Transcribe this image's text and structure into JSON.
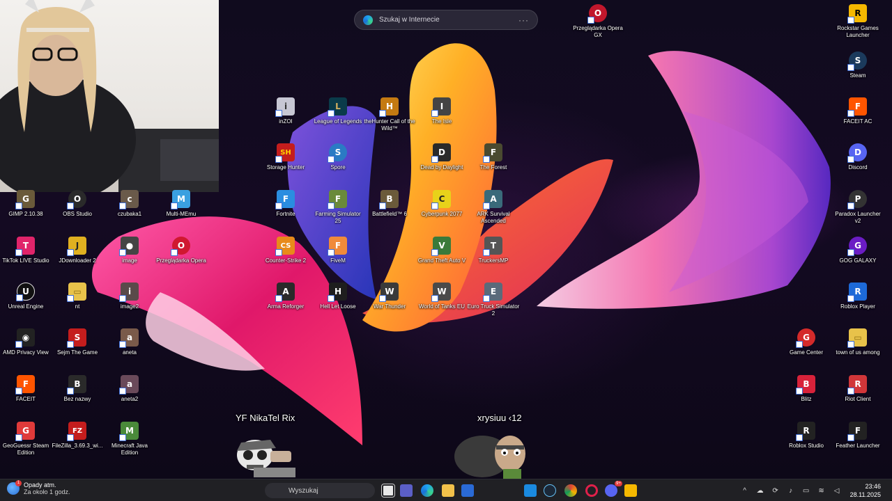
{
  "browser_search": {
    "placeholder": "Szukaj w Internecie",
    "more": "···"
  },
  "overlay": {
    "player1": "YF NikaTel Rix",
    "player2": "xrysiuu ‹12"
  },
  "icons": [
    {
      "id": "opera-gx",
      "label": "Przeglądarka Opera GX",
      "color": "#c1172c",
      "glyph": "O"
    },
    {
      "id": "rockstar",
      "label": "Rockstar Games Launcher",
      "color": "#f5b800",
      "glyph": "R"
    },
    {
      "id": "steam",
      "label": "Steam",
      "color": "#1b3a5c",
      "glyph": "S"
    },
    {
      "id": "faceit-ac",
      "label": "FACEIT AC",
      "color": "#ff5500",
      "glyph": "F"
    },
    {
      "id": "discord",
      "label": "Discord",
      "color": "#5865f2",
      "glyph": "D"
    },
    {
      "id": "paradox",
      "label": "Paradox Launcher v2",
      "color": "#333",
      "glyph": "P"
    },
    {
      "id": "gog",
      "label": "GOG GALAXY",
      "color": "#6b1cc4",
      "glyph": "G"
    },
    {
      "id": "roblox-player",
      "label": "Roblox Player",
      "color": "#1d6ad8",
      "glyph": "R"
    },
    {
      "id": "game-center",
      "label": "Game Center",
      "color": "#d42a2a",
      "glyph": "G"
    },
    {
      "id": "town-of-us",
      "label": "town of us among",
      "color": "#e8c24a",
      "glyph": "▭"
    },
    {
      "id": "blitz",
      "label": "Blitz",
      "color": "#d8223a",
      "glyph": "B"
    },
    {
      "id": "riot-client",
      "label": "Riot Client",
      "color": "#d13639",
      "glyph": "R"
    },
    {
      "id": "roblox-studio",
      "label": "Roblox Studio",
      "color": "#222",
      "glyph": "R"
    },
    {
      "id": "feather",
      "label": "Feather Launcher",
      "color": "#222",
      "glyph": "F"
    },
    {
      "id": "inzoi",
      "label": "inZOI",
      "color": "#c7c7d4",
      "glyph": "i"
    },
    {
      "id": "lol",
      "label": "League of Legends",
      "color": "#0a3b4a",
      "glyph": "L"
    },
    {
      "id": "thehunter",
      "label": "theHunter Call of the Wild™",
      "color": "#c47a12",
      "glyph": "H"
    },
    {
      "id": "the-isle",
      "label": "The Isle",
      "color": "#444",
      "glyph": "I"
    },
    {
      "id": "storage-hunter",
      "label": "Storage Hunter",
      "color": "#c41d1d",
      "glyph": "SH"
    },
    {
      "id": "spore",
      "label": "Spore",
      "color": "#2a7bc4",
      "glyph": "S"
    },
    {
      "id": "dead-by",
      "label": "Dead by Daylight",
      "color": "#2a2a2a",
      "glyph": "D"
    },
    {
      "id": "the-forest",
      "label": "The Forest",
      "color": "#4a4a30",
      "glyph": "F"
    },
    {
      "id": "fortnite",
      "label": "Fortnite",
      "color": "#2a8de0",
      "glyph": "F"
    },
    {
      "id": "farming-sim",
      "label": "Farming Simulator 25",
      "color": "#6a8a3a",
      "glyph": "F"
    },
    {
      "id": "battlefield",
      "label": "Battlefield™ 6",
      "color": "#6b5a3a",
      "glyph": "B"
    },
    {
      "id": "cyberpunk",
      "label": "Cyberpunk 2077",
      "color": "#e8d21a",
      "glyph": "C"
    },
    {
      "id": "ark",
      "label": "ARK Survival Ascended",
      "color": "#3a6a7a",
      "glyph": "A"
    },
    {
      "id": "cs2",
      "label": "Counter-Strike 2",
      "color": "#e88a1a",
      "glyph": "CS"
    },
    {
      "id": "fivem",
      "label": "FiveM",
      "color": "#f08a3a",
      "glyph": "F"
    },
    {
      "id": "gta5",
      "label": "Grand Theft Auto V",
      "color": "#3a7a3a",
      "glyph": "V"
    },
    {
      "id": "truckersmp",
      "label": "TruckersMP",
      "color": "#555",
      "glyph": "T"
    },
    {
      "id": "arma",
      "label": "Arma Reforger",
      "color": "#2a2a2a",
      "glyph": "A"
    },
    {
      "id": "hell-let-loose",
      "label": "Hell Let Loose",
      "color": "#1e1e1e",
      "glyph": "H"
    },
    {
      "id": "war-thunder",
      "label": "War Thunder",
      "color": "#3a3a3a",
      "glyph": "W"
    },
    {
      "id": "wot",
      "label": "World of Tanks EU",
      "color": "#4a4a4a",
      "glyph": "W"
    },
    {
      "id": "ets2",
      "label": "Euro Truck Simulator 2",
      "color": "#5a6a7a",
      "glyph": "E"
    },
    {
      "id": "gimp",
      "label": "GIMP 2.10.38",
      "color": "#6a5a3a",
      "glyph": "G"
    },
    {
      "id": "obs",
      "label": "OBS Studio",
      "color": "#2a2a2a",
      "glyph": "O"
    },
    {
      "id": "czubaka1",
      "label": "czubaka1",
      "color": "#6a5a4a",
      "glyph": "c"
    },
    {
      "id": "multi-memu",
      "label": "Multi-MEmu",
      "color": "#3aa0e0",
      "glyph": "M"
    },
    {
      "id": "tiktok-live",
      "label": "TikTok LIVE Studio",
      "color": "#e0246a",
      "glyph": "T"
    },
    {
      "id": "jdownloader",
      "label": "JDownloader 2",
      "color": "#e0b020",
      "glyph": "J"
    },
    {
      "id": "image",
      "label": "image",
      "color": "#444",
      "glyph": "●"
    },
    {
      "id": "opera",
      "label": "Przeglądarka Opera",
      "color": "#d01830",
      "glyph": "O"
    },
    {
      "id": "unreal",
      "label": "Unreal Engine",
      "color": "#111",
      "glyph": "U"
    },
    {
      "id": "nt",
      "label": "nt",
      "color": "#e8c24a",
      "glyph": "▭"
    },
    {
      "id": "image2",
      "label": "image2",
      "color": "#5a4a4a",
      "glyph": "i"
    },
    {
      "id": "amd-privacy",
      "label": "AMD Privacy View",
      "color": "#222",
      "glyph": "◉"
    },
    {
      "id": "sejm",
      "label": "Sejm The Game",
      "color": "#c41d1d",
      "glyph": "S"
    },
    {
      "id": "aneta",
      "label": "aneta",
      "color": "#7a5a4a",
      "glyph": "a"
    },
    {
      "id": "faceit",
      "label": "FACEIT",
      "color": "#ff5500",
      "glyph": "F"
    },
    {
      "id": "bez-nazwy",
      "label": "Bez nazwy",
      "color": "#2a2a2a",
      "glyph": "B"
    },
    {
      "id": "aneta2",
      "label": "aneta2",
      "color": "#6a4a5a",
      "glyph": "a"
    },
    {
      "id": "geoguessr",
      "label": "GeoGuessr Steam Edition",
      "color": "#e03a3a",
      "glyph": "G"
    },
    {
      "id": "filezilla",
      "label": "FileZilla_3.69.3_wi...",
      "color": "#c41d1d",
      "glyph": "FZ"
    },
    {
      "id": "minecraft",
      "label": "Minecraft Java Edition",
      "color": "#4a8a3a",
      "glyph": "M"
    }
  ],
  "taskbar": {
    "weather_title": "Opady atm.",
    "weather_sub": "Za około 1 godz.",
    "weather_badge": "1",
    "search_placeholder": "Wyszukaj",
    "time": "23:46",
    "date": "28.11.2025",
    "discord_badge": "9+"
  },
  "colors": {
    "taskbar": "#202024",
    "accent": "#0078d4"
  }
}
